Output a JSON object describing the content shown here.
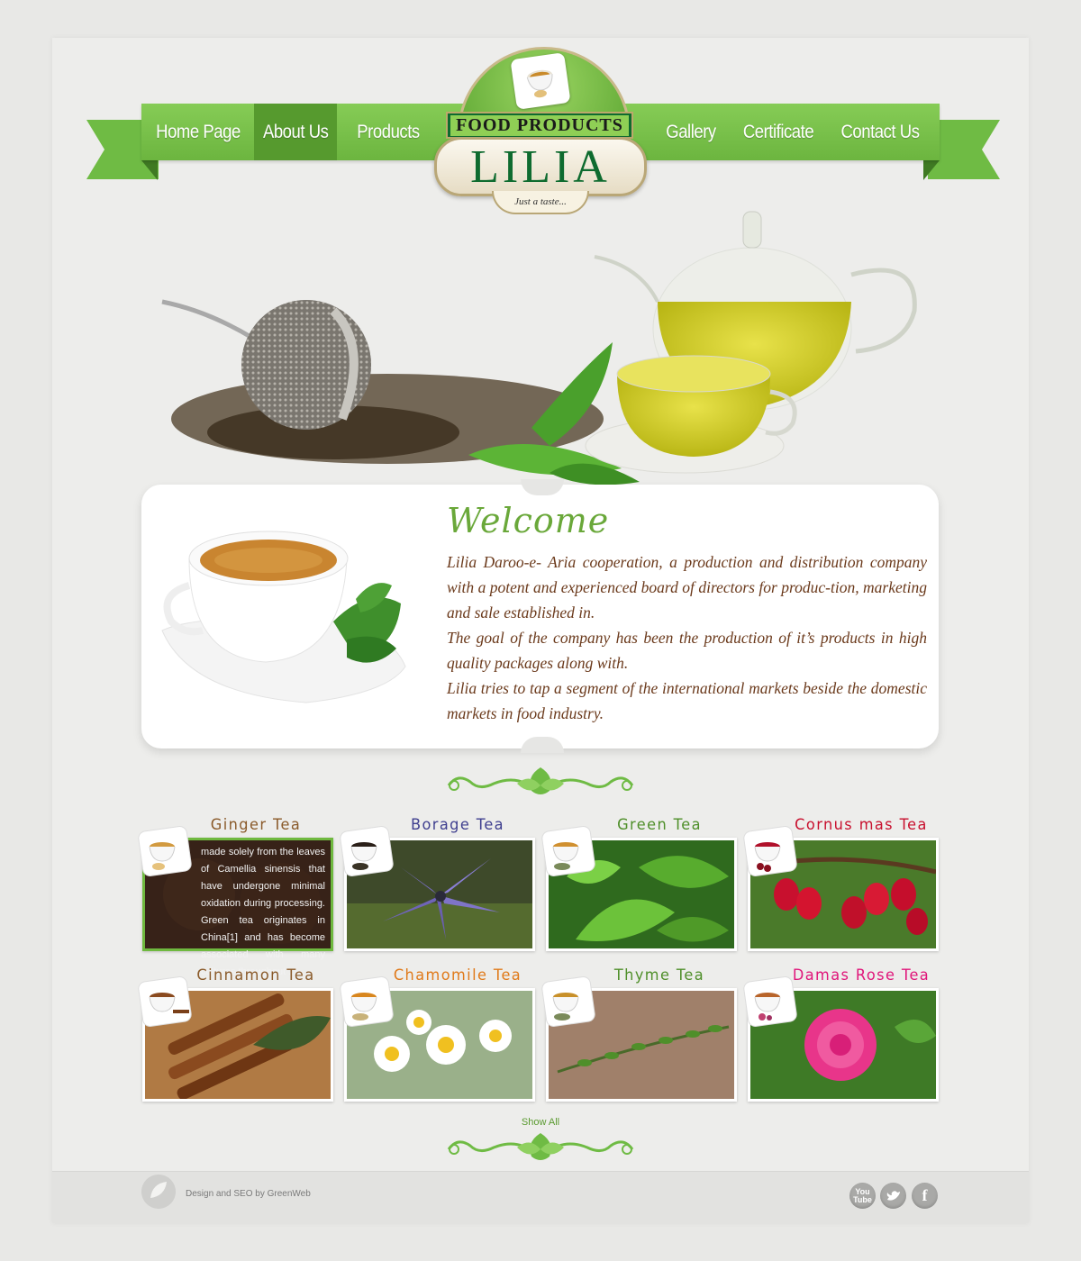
{
  "nav": {
    "left": [
      "Home Page",
      "About Us",
      "Products"
    ],
    "right": [
      "Gallery",
      "Certificate",
      "Contact Us"
    ],
    "active": "About Us"
  },
  "logo": {
    "band": "FOOD PRODUCTS",
    "name": "LILIA",
    "tagline": "Just a taste..."
  },
  "welcome": {
    "title": "Welcome",
    "paragraphs": [
      "Lilia Daroo-e- Aria cooperation, a production and distribution company  with a potent and experienced board of directors for produc-tion, marketing and sale established in.",
      "The goal of the company has been the production of it’s products in high quality packages along with.",
      "Lilia tries to tap a segment of the international markets beside the domestic markets in food industry."
    ]
  },
  "products": [
    {
      "name": "Ginger Tea",
      "color": "#8a5a2a",
      "overlay": "made solely from the leaves of Camellia sinensis that have undergone minimal oxidation during processing. Green tea originates in China[1] and has become associated with many cultures throughout ........"
    },
    {
      "name": "Borage Tea",
      "color": "#3f3f8f"
    },
    {
      "name": "Green Tea",
      "color": "#4f8f2a"
    },
    {
      "name": "Cornus mas Tea",
      "color": "#c8102e"
    },
    {
      "name": "Cinnamon Tea",
      "color": "#8a5a2a"
    },
    {
      "name": "Chamomile Tea",
      "color": "#e07a1a"
    },
    {
      "name": "Thyme Tea",
      "color": "#4f8f2a"
    },
    {
      "name": "Damas Rose Tea",
      "color": "#e0157a"
    }
  ],
  "show_all": "Show All",
  "footer": {
    "credit": "Design and SEO by GreenWeb",
    "social": [
      "You Tube",
      "twitter",
      "f"
    ]
  },
  "colors": {
    "brand_green": "#6fbb44",
    "brand_dark_green": "#0e6b2f",
    "text_brown": "#6b3a1c",
    "background": "#ededeb"
  }
}
